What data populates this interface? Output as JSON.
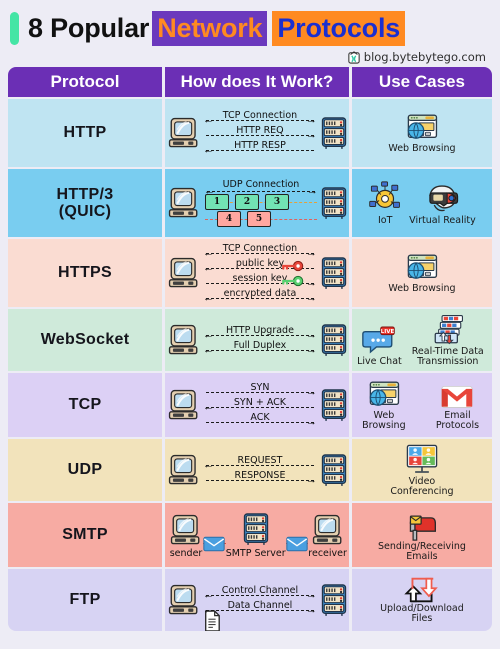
{
  "title": {
    "plain": "8 Popular",
    "highlight1": "Network",
    "highlight2": "Protocols",
    "accent_color": "#44e5a5",
    "highlight1_bg": "#6b39bd",
    "highlight1_fg": "#ff8a21",
    "highlight2_bg": "#ff8a21",
    "highlight2_fg": "#1a2fd0"
  },
  "watermark": {
    "text": "blog.bytebytego.com",
    "icon": "bytebytego-logo-icon"
  },
  "table": {
    "headers": {
      "protocol": "Protocol",
      "how": "How does It Work?",
      "use": "Use Cases"
    },
    "header_bg": "#6b2fb5",
    "rows": [
      {
        "protocol": "HTTP",
        "bg": "#bfe4f2",
        "diagram": {
          "type": "client-server",
          "lines": [
            {
              "label": "TCP Connection",
              "left_arrow": true,
              "right_arrow": true
            },
            {
              "label": "HTTP REQ",
              "left_arrow": false,
              "right_arrow": true
            },
            {
              "label": "HTTP RESP",
              "left_arrow": true,
              "right_arrow": false
            }
          ]
        },
        "use_cases": [
          {
            "label": "Web Browsing",
            "icon": "browser-globe-icon"
          }
        ]
      },
      {
        "protocol": "HTTP/3\n(QUIC)",
        "protocol_line1": "HTTP/3",
        "protocol_line2": "(QUIC)",
        "bg": "#79cdf0",
        "diagram": {
          "type": "quic",
          "lines": [
            {
              "label": "UDP Connection",
              "left_arrow": true,
              "right_arrow": true
            }
          ],
          "packets_row1": [
            "1",
            "2",
            "3"
          ],
          "packets_row2": [
            "4",
            "5"
          ],
          "packet_row1_color": "#72e3b4",
          "packet_row2_color": "#ffa7a0"
        },
        "use_cases": [
          {
            "label": "IoT",
            "icon": "iot-hub-icon"
          },
          {
            "label": "Virtual Reality",
            "icon": "vr-headset-icon"
          }
        ]
      },
      {
        "protocol": "HTTPS",
        "bg": "#fadcd2",
        "diagram": {
          "type": "client-server",
          "lines": [
            {
              "label": "TCP Connection",
              "left_arrow": true,
              "right_arrow": true
            },
            {
              "label": "public key",
              "left_arrow": true,
              "right_arrow": false,
              "icon": "red-key-icon"
            },
            {
              "label": "session key",
              "left_arrow": false,
              "right_arrow": true,
              "icon": "green-key-icon"
            },
            {
              "label": "encrypted data",
              "left_arrow": true,
              "right_arrow": true
            }
          ]
        },
        "use_cases": [
          {
            "label": "Web Browsing",
            "icon": "browser-globe-icon"
          }
        ]
      },
      {
        "protocol": "WebSocket",
        "bg": "#cfeada",
        "diagram": {
          "type": "client-server",
          "lines": [
            {
              "label": "HTTP Upgrade",
              "left_arrow": true,
              "right_arrow": true
            },
            {
              "label": "Full Duplex",
              "left_arrow": true,
              "right_arrow": true
            }
          ]
        },
        "use_cases": [
          {
            "label": "Live Chat",
            "icon": "chat-bubble-live-icon"
          },
          {
            "label": "Real-Time Data Transmission",
            "icon": "data-transfer-icon"
          }
        ]
      },
      {
        "protocol": "TCP",
        "bg": "#dcd0f5",
        "diagram": {
          "type": "client-server",
          "lines": [
            {
              "label": "SYN",
              "left_arrow": false,
              "right_arrow": true
            },
            {
              "label": "SYN + ACK",
              "left_arrow": true,
              "right_arrow": false
            },
            {
              "label": "ACK",
              "left_arrow": false,
              "right_arrow": true
            }
          ]
        },
        "use_cases": [
          {
            "label": "Web Browsing",
            "icon": "browser-globe-icon"
          },
          {
            "label": "Email Protocols",
            "icon": "gmail-icon"
          }
        ]
      },
      {
        "protocol": "UDP",
        "bg": "#f2e3bb",
        "diagram": {
          "type": "client-server",
          "lines": [
            {
              "label": "REQUEST",
              "left_arrow": true,
              "right_arrow": false
            },
            {
              "label": "RESPONSE",
              "left_arrow": false,
              "right_arrow": true
            }
          ]
        },
        "use_cases": [
          {
            "label": "Video Conferencing",
            "icon": "video-grid-icon"
          }
        ]
      },
      {
        "protocol": "SMTP",
        "bg": "#f7aba3",
        "diagram": {
          "type": "smtp",
          "nodes": [
            {
              "label": "sender",
              "icon": "computer-icon"
            },
            {
              "label": "SMTP Server",
              "icon": "server-icon"
            },
            {
              "label": "receiver",
              "icon": "computer-icon"
            }
          ],
          "link_icon": "envelope-icon",
          "link_color": "#e04a3f"
        },
        "use_cases": [
          {
            "label": "Sending/Receiving Emails",
            "icon": "mailbox-icon"
          }
        ]
      },
      {
        "protocol": "FTP",
        "bg": "#d7d3f3",
        "diagram": {
          "type": "client-server",
          "lines": [
            {
              "label": "Control Channel",
              "left_arrow": true,
              "right_arrow": true
            },
            {
              "label": "Data Channel",
              "left_arrow": true,
              "right_arrow": true
            }
          ],
          "extra_icon": "document-icon"
        },
        "use_cases": [
          {
            "label": "Upload/Download Files",
            "icon": "upload-download-arrows-icon"
          }
        ]
      }
    ]
  }
}
